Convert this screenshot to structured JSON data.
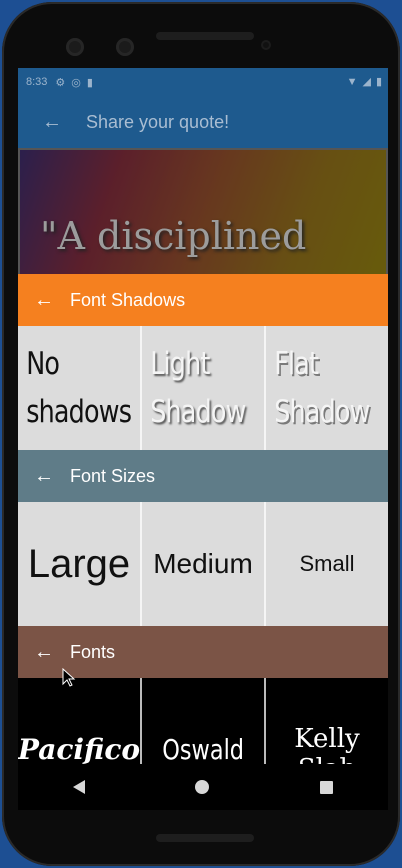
{
  "status_bar": {
    "time": "8:33",
    "icons": [
      "settings-icon",
      "sync-icon",
      "sd-card-icon"
    ],
    "right_icons": [
      "wifi-icon",
      "signal-icon",
      "battery-icon"
    ]
  },
  "appbar": {
    "title": "Share your quote!",
    "back_icon": "←"
  },
  "preview": {
    "quote_text": "\"A disciplined"
  },
  "shadows": {
    "header": "Font Shadows",
    "back_icon": "←",
    "options": [
      "No shadows",
      "Light Shadow",
      "Flat Shadow"
    ]
  },
  "sizes": {
    "header": "Font Sizes",
    "back_icon": "←",
    "options": [
      "Large",
      "Medium",
      "Small"
    ]
  },
  "fonts": {
    "header": "Fonts",
    "back_icon": "←",
    "options": [
      "Pacifico",
      "Oswald",
      "Kelly Slab"
    ]
  },
  "colors": {
    "appbar": "#1e5a8e",
    "shadows_header": "#f5801f",
    "sizes_header": "#5f7c88",
    "fonts_header": "#7b5446"
  }
}
